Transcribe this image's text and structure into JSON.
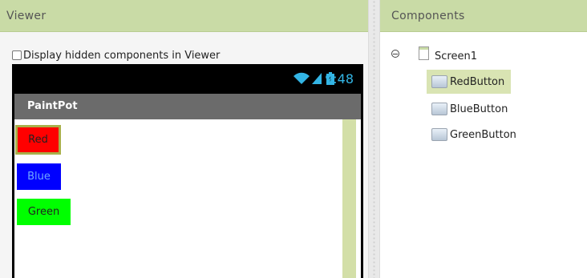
{
  "viewer": {
    "title": "Viewer",
    "hidden_components_label": "Display hidden components in Viewer",
    "hidden_components_checked": false,
    "phone": {
      "time": "9:48",
      "app_title": "PaintPot",
      "buttons": [
        {
          "label": "Red",
          "color": "#ff0000"
        },
        {
          "label": "Blue",
          "color": "#0000ff"
        },
        {
          "label": "Green",
          "color": "#00ff00"
        }
      ]
    }
  },
  "components": {
    "title": "Components",
    "root": "Screen1",
    "children": [
      {
        "label": "RedButton",
        "selected": true
      },
      {
        "label": "BlueButton",
        "selected": false
      },
      {
        "label": "GreenButton",
        "selected": false
      }
    ]
  },
  "colors": {
    "header_bg": "#c9dba6",
    "status_time": "#33b5e5",
    "title_bar": "#6b6b6b",
    "selection": "#d9e4b3"
  }
}
